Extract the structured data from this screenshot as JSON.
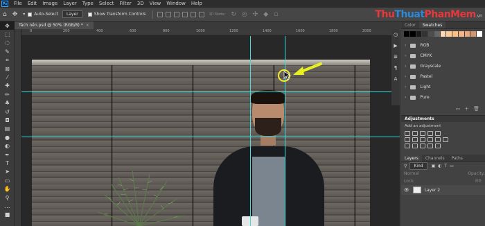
{
  "menu": {
    "logo": "Ps",
    "items": [
      "File",
      "Edit",
      "Image",
      "Layer",
      "Type",
      "Select",
      "Filter",
      "3D",
      "View",
      "Window",
      "Help"
    ]
  },
  "options": {
    "auto_select_label": "Auto-Select",
    "layer_select": "Layer",
    "show_transform_label": "Show Transform Controls",
    "mode_3d_label": "3D Mode:"
  },
  "brand": {
    "part1": "Thu",
    "part2": "Thuat",
    "part3": "PhanMem",
    "suffix": ".vn"
  },
  "document": {
    "tab_title": "Tách nền.psd @ 50% (RGB/8) *",
    "close": "×"
  },
  "ruler": {
    "labels": [
      "0",
      "200",
      "400",
      "600",
      "800",
      "1000",
      "1200",
      "1400",
      "1600",
      "1800",
      "2000"
    ]
  },
  "panel": {
    "tabs": [
      "Color",
      "Swatches"
    ],
    "active_tab": "Swatches",
    "swatch_colors": [
      "#000000",
      "#000000",
      "#1a1a1a",
      "#333333",
      "#4d4d4d",
      "#666666",
      "#ffd9b3",
      "#ffcc99",
      "#ffbf80",
      "#f5b589",
      "#e8a87c",
      "#d4956a",
      "#ffffff"
    ],
    "groups": [
      "RGB",
      "CMYK",
      "Grayscale",
      "Pastel",
      "Light",
      "Pure"
    ],
    "adjustments_title": "Adjustments",
    "adjustments_hint": "Add an adjustment",
    "layers_tabs": [
      "Layers",
      "Channels",
      "Paths"
    ],
    "kind_label": "Kind",
    "opacity_label": "Opacity:",
    "lock_label": "Lock:",
    "fill_label": "Fill:",
    "layer_name": "Layer 2"
  },
  "colors": {
    "guide": "#3fe0e0",
    "cursor_highlight": "#f5ee2a",
    "arrow": "#e8f020"
  }
}
